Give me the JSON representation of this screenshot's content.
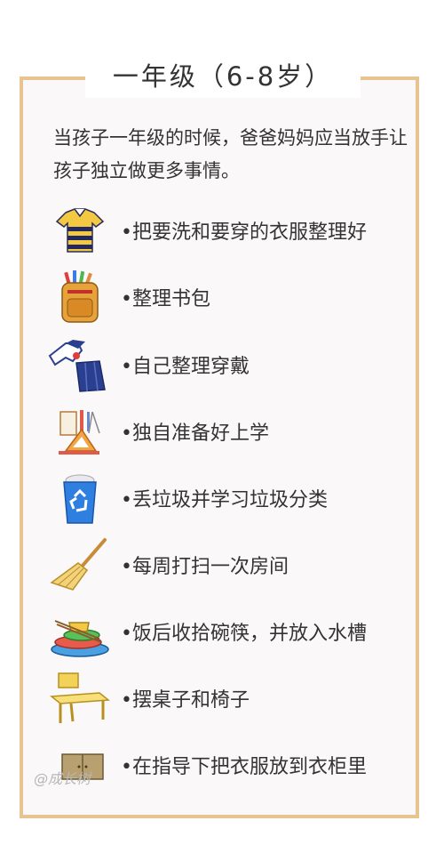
{
  "title": "一年级（6-8岁）",
  "intro": "当孩子一年级的时候，爸爸妈妈应当放手让孩子独立做更多事情。",
  "items": [
    {
      "icon": "shirt-icon",
      "label": "•把要洗和要穿的衣服整理好"
    },
    {
      "icon": "backpack-icon",
      "label": "•整理书包"
    },
    {
      "icon": "uniform-icon",
      "label": "•自己整理穿戴"
    },
    {
      "icon": "stationery-icon",
      "label": "•独自准备好上学"
    },
    {
      "icon": "recycle-bin-icon",
      "label": "•丢垃圾并学习垃圾分类"
    },
    {
      "icon": "broom-icon",
      "label": "•每周打扫一次房间"
    },
    {
      "icon": "dishes-icon",
      "label": "•饭后收拾碗筷，并放入水槽"
    },
    {
      "icon": "desk-chair-icon",
      "label": "•摆桌子和椅子"
    },
    {
      "icon": "wardrobe-icon",
      "label": "•在指导下把衣服放到衣柜里"
    }
  ],
  "watermark": "@成长树",
  "colors": {
    "border": "#e8c590",
    "card_bg": "#faf8f8",
    "text": "#333333"
  }
}
